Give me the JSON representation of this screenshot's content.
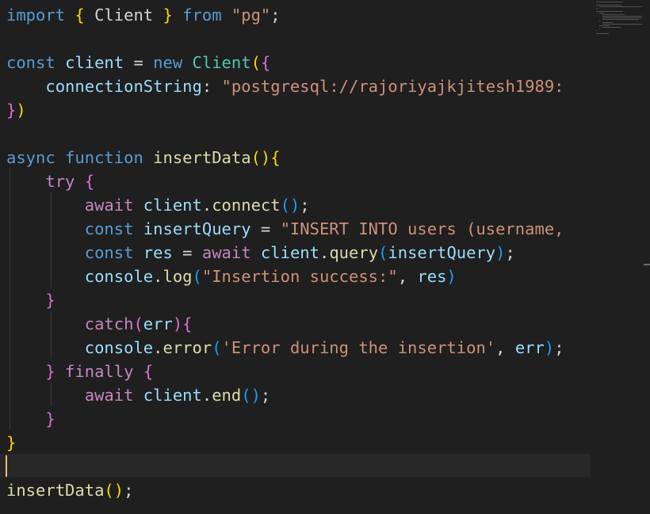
{
  "editor": {
    "lines": [
      {
        "segments": [
          {
            "text": "import ",
            "cls": "kw"
          },
          {
            "text": "{",
            "cls": "b1"
          },
          {
            "text": " Client ",
            "cls": "plain"
          },
          {
            "text": "}",
            "cls": "b1"
          },
          {
            "text": " from ",
            "cls": "kw"
          },
          {
            "text": "\"pg\"",
            "cls": "str"
          },
          {
            "text": ";",
            "cls": "plain"
          }
        ]
      },
      {
        "segments": []
      },
      {
        "segments": [
          {
            "text": "const ",
            "cls": "kw"
          },
          {
            "text": "client",
            "cls": "var"
          },
          {
            "text": " = ",
            "cls": "plain"
          },
          {
            "text": "new ",
            "cls": "kw"
          },
          {
            "text": "Client",
            "cls": "cls"
          },
          {
            "text": "(",
            "cls": "b1"
          },
          {
            "text": "{",
            "cls": "b2"
          }
        ]
      },
      {
        "segments": [
          {
            "text": "    connectionString",
            "cls": "var"
          },
          {
            "text": ": ",
            "cls": "plain"
          },
          {
            "text": "\"postgresql://rajoriyajkjitesh1989:",
            "cls": "str"
          }
        ]
      },
      {
        "segments": [
          {
            "text": "}",
            "cls": "b2"
          },
          {
            "text": ")",
            "cls": "b1"
          }
        ]
      },
      {
        "segments": []
      },
      {
        "segments": [
          {
            "text": "async ",
            "cls": "kw"
          },
          {
            "text": "function ",
            "cls": "kw"
          },
          {
            "text": "insertData",
            "cls": "fn"
          },
          {
            "text": "()",
            "cls": "b1"
          },
          {
            "text": "{",
            "cls": "b1"
          }
        ]
      },
      {
        "segments": [
          {
            "text": "    try ",
            "cls": "ctl"
          },
          {
            "text": "{",
            "cls": "b2"
          }
        ]
      },
      {
        "segments": [
          {
            "text": "        await ",
            "cls": "ctl"
          },
          {
            "text": "client",
            "cls": "var"
          },
          {
            "text": ".",
            "cls": "plain"
          },
          {
            "text": "connect",
            "cls": "fn"
          },
          {
            "text": "()",
            "cls": "b3"
          },
          {
            "text": ";",
            "cls": "plain"
          }
        ]
      },
      {
        "segments": [
          {
            "text": "        const ",
            "cls": "kw"
          },
          {
            "text": "insertQuery",
            "cls": "var"
          },
          {
            "text": " = ",
            "cls": "plain"
          },
          {
            "text": "\"INSERT INTO users (username,",
            "cls": "str"
          }
        ]
      },
      {
        "segments": [
          {
            "text": "        const ",
            "cls": "kw"
          },
          {
            "text": "res",
            "cls": "var"
          },
          {
            "text": " = ",
            "cls": "plain"
          },
          {
            "text": "await ",
            "cls": "ctl"
          },
          {
            "text": "client",
            "cls": "var"
          },
          {
            "text": ".",
            "cls": "plain"
          },
          {
            "text": "query",
            "cls": "fn"
          },
          {
            "text": "(",
            "cls": "b3"
          },
          {
            "text": "insertQuery",
            "cls": "var"
          },
          {
            "text": ")",
            "cls": "b3"
          },
          {
            "text": ";",
            "cls": "plain"
          }
        ]
      },
      {
        "segments": [
          {
            "text": "        console",
            "cls": "var"
          },
          {
            "text": ".",
            "cls": "plain"
          },
          {
            "text": "log",
            "cls": "fn"
          },
          {
            "text": "(",
            "cls": "b3"
          },
          {
            "text": "\"Insertion success:\"",
            "cls": "str"
          },
          {
            "text": ", ",
            "cls": "plain"
          },
          {
            "text": "res",
            "cls": "var"
          },
          {
            "text": ")",
            "cls": "b3"
          }
        ]
      },
      {
        "segments": [
          {
            "text": "    }",
            "cls": "b2"
          }
        ]
      },
      {
        "segments": [
          {
            "text": "        catch",
            "cls": "ctl"
          },
          {
            "text": "(",
            "cls": "b2"
          },
          {
            "text": "err",
            "cls": "var"
          },
          {
            "text": ")",
            "cls": "b2"
          },
          {
            "text": "{",
            "cls": "b2"
          }
        ]
      },
      {
        "segments": [
          {
            "text": "        console",
            "cls": "var"
          },
          {
            "text": ".",
            "cls": "plain"
          },
          {
            "text": "error",
            "cls": "fn"
          },
          {
            "text": "(",
            "cls": "b3"
          },
          {
            "text": "'Error during the insertion'",
            "cls": "str"
          },
          {
            "text": ", ",
            "cls": "plain"
          },
          {
            "text": "err",
            "cls": "var"
          },
          {
            "text": ")",
            "cls": "b3"
          },
          {
            "text": ";",
            "cls": "plain"
          }
        ]
      },
      {
        "segments": [
          {
            "text": "    }",
            "cls": "b2"
          },
          {
            "text": " finally ",
            "cls": "ctl"
          },
          {
            "text": "{",
            "cls": "b2"
          }
        ]
      },
      {
        "segments": [
          {
            "text": "        await ",
            "cls": "ctl"
          },
          {
            "text": "client",
            "cls": "var"
          },
          {
            "text": ".",
            "cls": "plain"
          },
          {
            "text": "end",
            "cls": "fn"
          },
          {
            "text": "()",
            "cls": "b3"
          },
          {
            "text": ";",
            "cls": "plain"
          }
        ]
      },
      {
        "segments": [
          {
            "text": "    }",
            "cls": "b2"
          }
        ]
      },
      {
        "segments": [
          {
            "text": "}",
            "cls": "b1"
          }
        ]
      },
      {
        "segments": []
      },
      {
        "segments": [
          {
            "text": "insertData",
            "cls": "fn"
          },
          {
            "text": "()",
            "cls": "b1"
          },
          {
            "text": ";",
            "cls": "plain"
          }
        ]
      }
    ],
    "cursor_line": 20
  }
}
